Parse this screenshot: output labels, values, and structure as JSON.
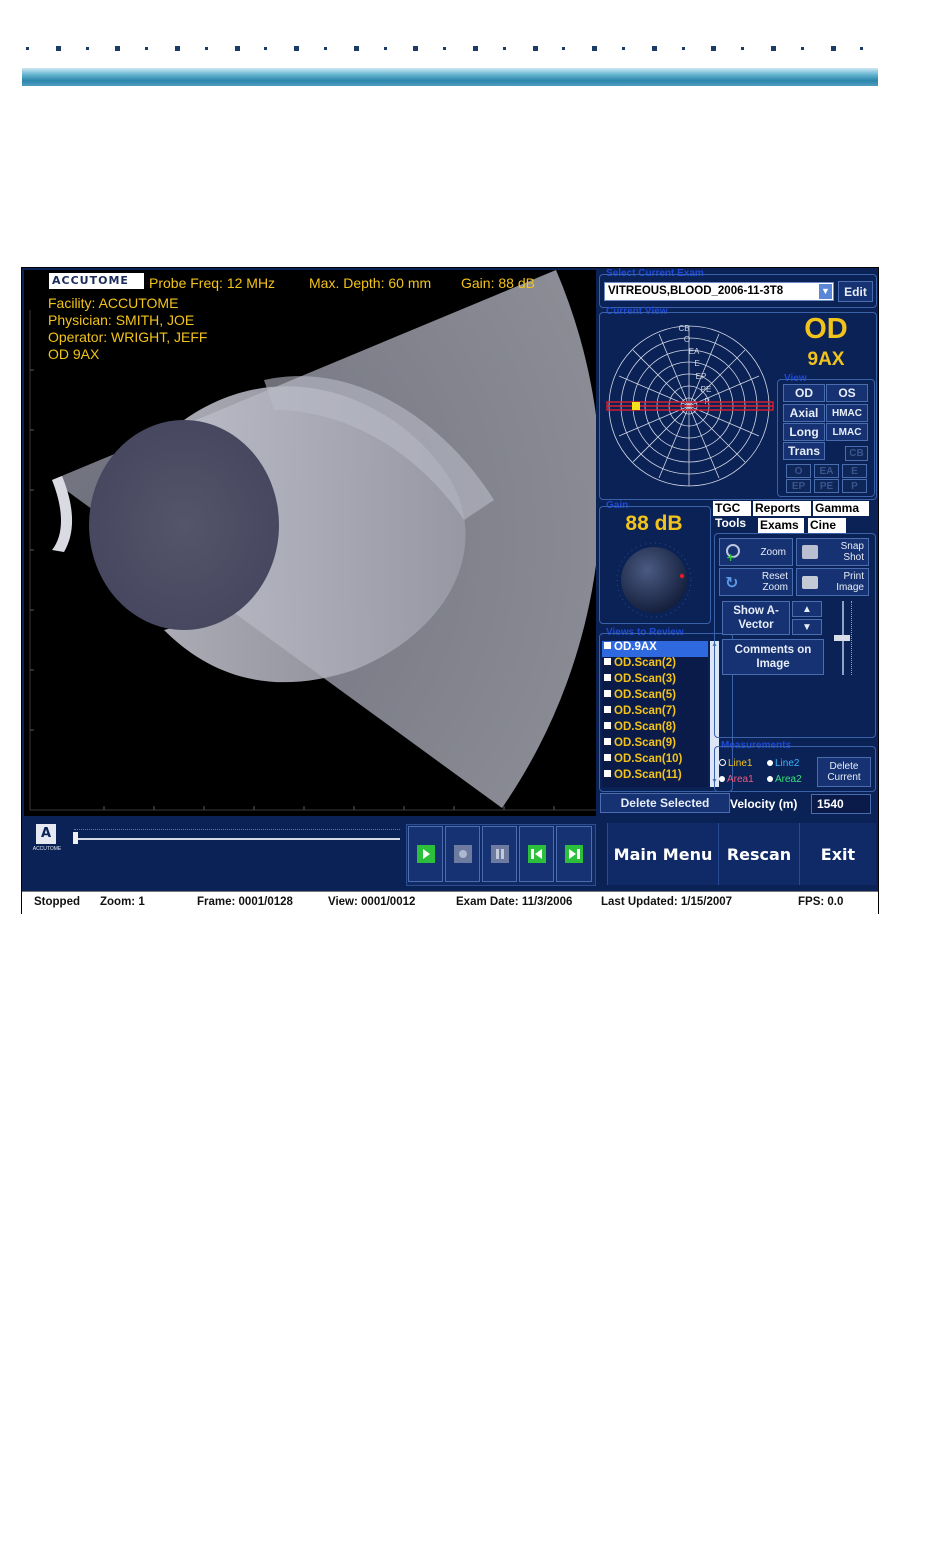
{
  "viewer": {
    "logo": "ACCUTOME",
    "probe_freq": "Probe Freq: 12 MHz",
    "max_depth": "Max. Depth: 60 mm",
    "gain": "Gain: 88 dB",
    "facility": "Facility: ACCUTOME",
    "physician": "Physician: SMITH, JOE",
    "operator": "Operator: WRIGHT, JEFF",
    "view_code": "OD  9AX"
  },
  "right_panel": {
    "exam_select_label": "Select Current Exam",
    "exam_value": "VITREOUS,BLOOD_2006-11-3T8",
    "edit_label": "Edit",
    "current_view_label": "Current View",
    "eye": "OD",
    "view": "9AX",
    "polar_labels": [
      "CB",
      "O",
      "EA",
      "E",
      "EP",
      "PE",
      "P"
    ],
    "view_panel_label": "View",
    "view_buttons": [
      "OD",
      "OS",
      "Axial",
      "HMAC",
      "Long",
      "LMAC",
      "Trans",
      "CB",
      "O",
      "EA",
      "E",
      "EP",
      "PE",
      "P"
    ],
    "gain_label": "Gain",
    "gain_value": "88 dB",
    "review_label": "Views to Review",
    "review_items": [
      "OD.9AX",
      "OD.Scan(2)",
      "OD.Scan(3)",
      "OD.Scan(5)",
      "OD.Scan(7)",
      "OD.Scan(8)",
      "OD.Scan(9)",
      "OD.Scan(10)",
      "OD.Scan(11)"
    ],
    "delete_selected": "Delete Selected",
    "tabs_row1": [
      "TGC",
      "Reports",
      "Gamma"
    ],
    "tabs_row2": [
      "Tools",
      "Exams",
      "Cine"
    ],
    "tools": {
      "zoom": "Zoom",
      "snap_shot": "Snap Shot",
      "reset_zoom": "Reset Zoom",
      "print_image": "Print Image",
      "show_avector": "Show A-Vector",
      "comments": "Comments on Image"
    },
    "measurements_label": "Measurements",
    "line1": "Line1",
    "line2": "Line2",
    "area1": "Area1",
    "area2": "Area2",
    "delete_current": "Delete Current",
    "velocity_label": "Velocity (m)",
    "velocity_value": "1540"
  },
  "bottom": {
    "brand": "ACCUTOME",
    "main_menu": "Main Menu",
    "rescan": "Rescan",
    "exit": "Exit"
  },
  "status": {
    "state": "Stopped",
    "zoom": "Zoom: 1",
    "frame": "Frame: 0001/0128",
    "view": "View: 0001/0012",
    "exam_date": "Exam Date: 11/3/2006",
    "last_updated": "Last Updated: 1/15/2007",
    "fps": "FPS: 0.0"
  },
  "colors": {
    "panel_bg": "#0b2256",
    "accent_yellow": "#f2c31b",
    "label_blue": "#1d49d6",
    "play_green": "#2bbf3b"
  }
}
